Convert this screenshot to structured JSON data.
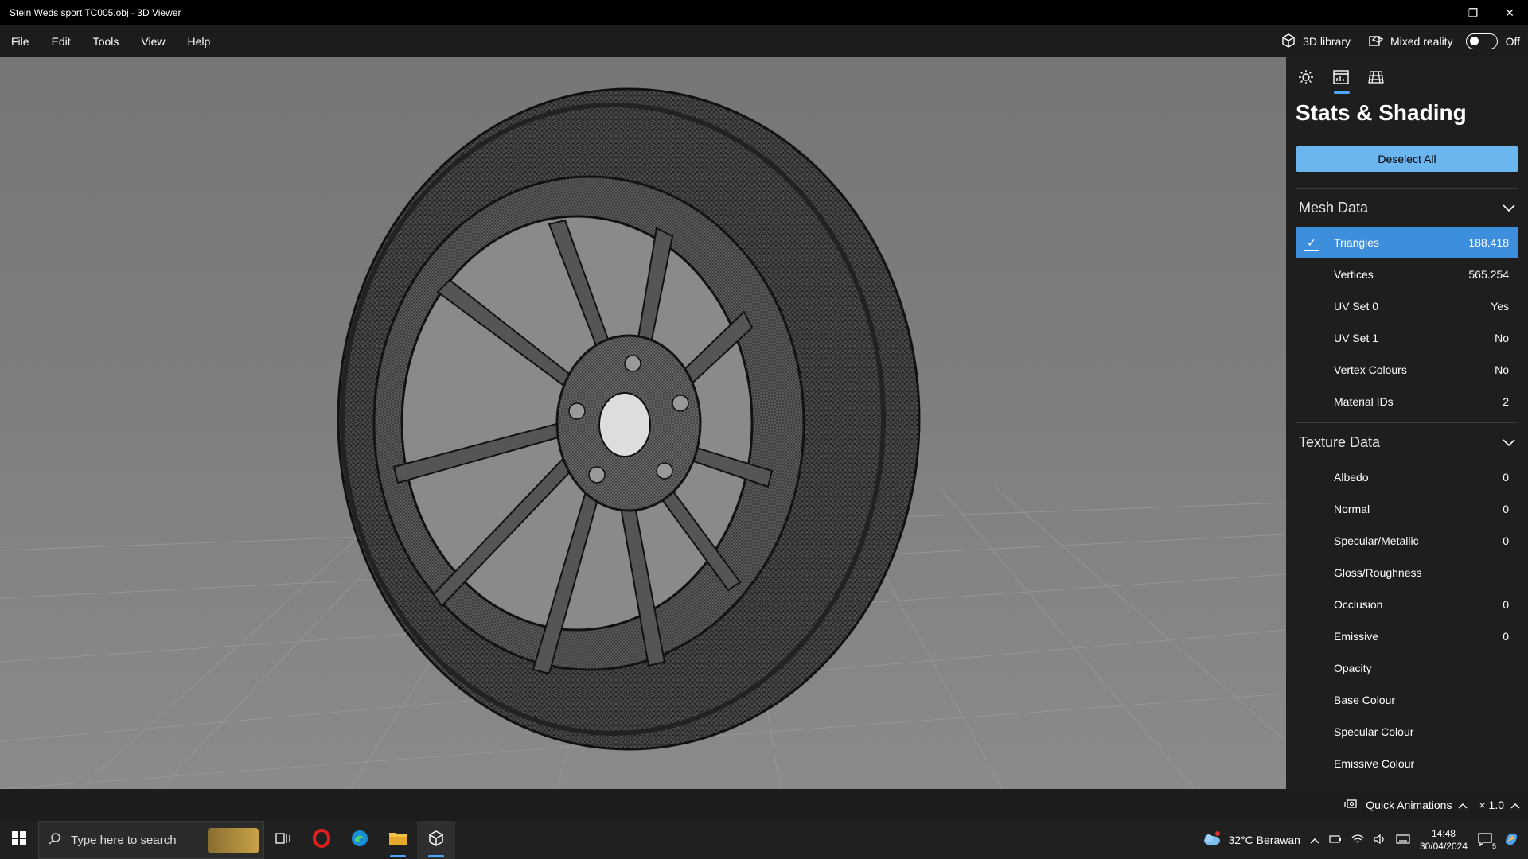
{
  "window": {
    "title": "Stein Weds sport TC005.obj - 3D Viewer",
    "minimize": "—",
    "restore": "❐",
    "close": "✕"
  },
  "menu": {
    "items": [
      "File",
      "Edit",
      "Tools",
      "View",
      "Help"
    ],
    "library_label": "3D library",
    "mixed_reality_label": "Mixed reality",
    "mixed_reality_state": "Off"
  },
  "panel": {
    "title": "Stats & Shading",
    "deselect_label": "Deselect All",
    "mesh_section": "Mesh Data",
    "mesh_rows": [
      {
        "label": "Triangles",
        "value": "188.418"
      },
      {
        "label": "Vertices",
        "value": "565.254"
      },
      {
        "label": "UV Set 0",
        "value": "Yes"
      },
      {
        "label": "UV Set 1",
        "value": "No"
      },
      {
        "label": "Vertex Colours",
        "value": "No"
      },
      {
        "label": "Material IDs",
        "value": "2"
      }
    ],
    "texture_section": "Texture Data",
    "texture_rows": [
      {
        "label": "Albedo",
        "value": "0"
      },
      {
        "label": "Normal",
        "value": "0"
      },
      {
        "label": "Specular/Metallic",
        "value": "0"
      },
      {
        "label": "Gloss/Roughness",
        "value": ""
      },
      {
        "label": "Occlusion",
        "value": "0"
      },
      {
        "label": "Emissive",
        "value": "0"
      },
      {
        "label": "Opacity",
        "value": ""
      },
      {
        "label": "Base Colour",
        "value": ""
      },
      {
        "label": "Specular Colour",
        "value": ""
      },
      {
        "label": "Emissive Colour",
        "value": ""
      }
    ]
  },
  "status": {
    "quick_animations": "Quick Animations",
    "speed": "× 1.0"
  },
  "taskbar": {
    "search_placeholder": "Type here to search",
    "weather": "32°C  Berawan",
    "time": "14:48",
    "date": "30/04/2024",
    "notif_count": "5"
  },
  "colors": {
    "accent": "#3e8ede",
    "button": "#6bb6ee",
    "panel_bg": "#1e1e1e",
    "viewport_bg": "#7a7a7a"
  }
}
